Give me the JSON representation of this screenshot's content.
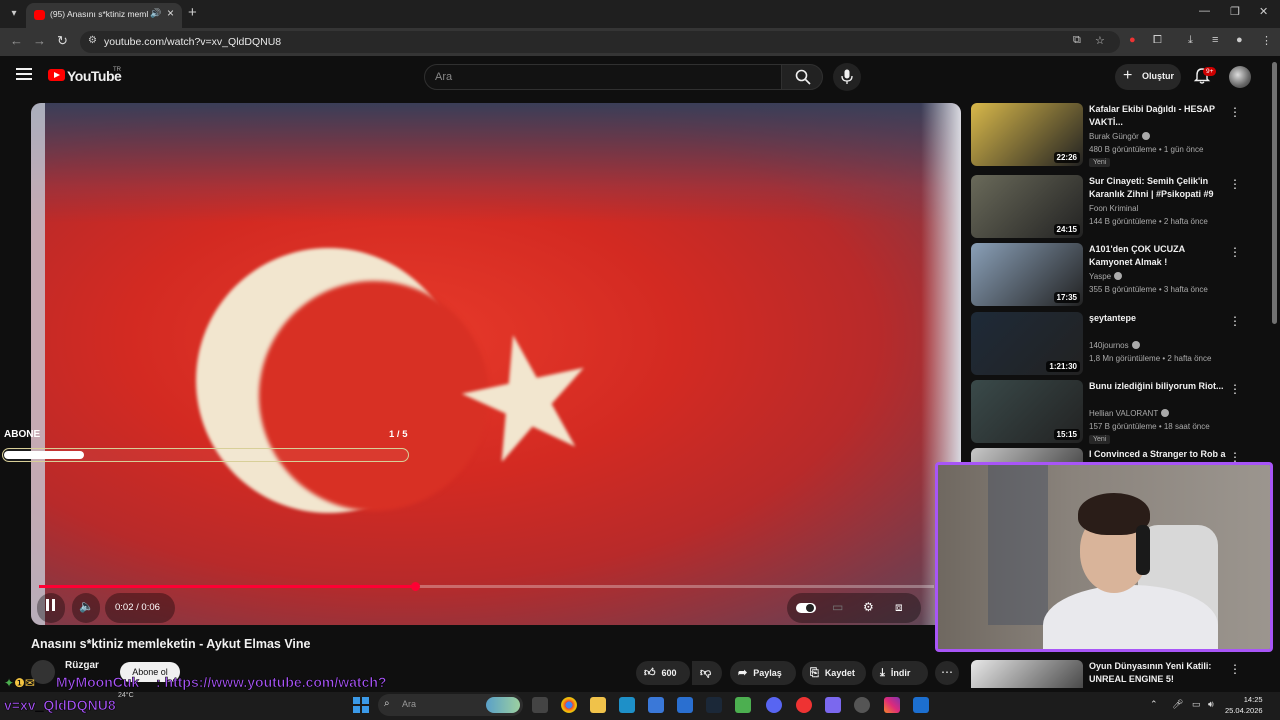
{
  "browser": {
    "tab_title": "(95) Anasını s*ktiniz memle",
    "url": "youtube.com/watch?v=xv_QldDQNU8"
  },
  "youtube": {
    "logo_text": "YouTube",
    "region": "TR",
    "search_placeholder": "Ara",
    "create_label": "Oluştur",
    "notifications": "9+"
  },
  "player": {
    "time": "0:02 / 0:06",
    "progress": 0.42
  },
  "overlay": {
    "abone_label": "ABONE",
    "abone_count": "1 / 5",
    "abone_progress": 0.2
  },
  "video": {
    "title": "Anasını s*ktiniz memleketin - Aykut Elmas Vine",
    "channel": "Rüzgar",
    "subscribe_label": "Abone ol",
    "likes": "600",
    "share_label": "Paylaş",
    "save_label": "Kaydet",
    "download_label": "İndir"
  },
  "sidebar": {
    "items": [
      {
        "title": "Kafalar Ekibi Dağıldı - HESAP VAKTİ...",
        "channel": "Burak Güngör",
        "meta": "480 B görüntüleme • 1 gün önce",
        "badge": "Yeni",
        "duration": "22:26",
        "thumb_color": "#d8b84a",
        "verified": true
      },
      {
        "title": "Sur Cinayeti: Semih Çelik'in Karanlık Zihni | #Psikopati #9",
        "channel": "Foon Kriminal",
        "meta": "144 B görüntüleme • 2 hafta önce",
        "badge": "",
        "duration": "24:15",
        "thumb_color": "#6a6a5a",
        "verified": false
      },
      {
        "title": "A101'den ÇOK UCUZA Kamyonet Almak !",
        "channel": "Yaspe",
        "meta": "355 B görüntüleme • 3 hafta önce",
        "badge": "",
        "duration": "17:35",
        "thumb_color": "#8aa0b8",
        "verified": true
      },
      {
        "title": "şeytantepe",
        "channel": "140journos",
        "meta": "1,8 Mn görüntüleme • 2 hafta önce",
        "badge": "",
        "duration": "1:21:30",
        "thumb_color": "#1e2a38",
        "verified": true
      },
      {
        "title": "Bunu izlediğini biliyorum Riot...",
        "channel": "Hellian VALORANT",
        "meta": "157 B görüntüleme • 18 saat önce",
        "badge": "Yeni",
        "duration": "15:15",
        "thumb_color": "#3a4a4a",
        "verified": true
      },
      {
        "title": "I Convinced a Stranger to Rob a",
        "channel": "",
        "meta": "",
        "badge": "",
        "duration": "",
        "thumb_color": "#c8c8c8",
        "verified": false
      },
      {
        "title": "Oyun Dünyasının Yeni Katili: UNREAL ENGINE 5!",
        "channel": "",
        "meta": "",
        "badge": "",
        "duration": "",
        "thumb_color": "#e8e8e8",
        "verified": false
      }
    ]
  },
  "chat": {
    "user": "MyMoonCuk",
    "message": ": https://www.youtube.com/watch?",
    "message_cont": "v=xv_QldDQNU8"
  },
  "taskbar": {
    "search_placeholder": "Ara",
    "weather": "24°C",
    "time": "14:25",
    "date": "25.04.2026"
  }
}
